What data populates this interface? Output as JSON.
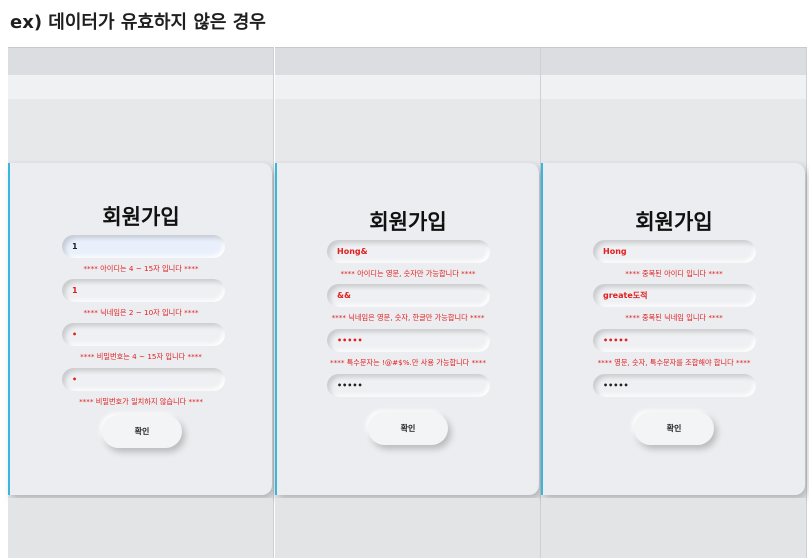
{
  "heading": "ex) 데이터가 유효하지 않은 경우",
  "panels": [
    {
      "title": "회원가입",
      "fields": [
        "1",
        "1",
        "•",
        "•"
      ],
      "errors": [
        "**** 아이디는 4 ~ 15자 입니다 ****",
        "**** 닉네임은 2 ~ 10자 입니다 ****",
        "**** 비밀번호는 4 ~ 15자 입니다 ****",
        "**** 비밀번호가 일치하지 않습니다 ****"
      ],
      "button": "확인"
    },
    {
      "title": "회원가입",
      "fields": [
        "Hong&",
        "&&",
        "•••••",
        "•••••"
      ],
      "errors": [
        "**** 아이디는 영문, 숫자만 가능합니다 ****",
        "**** 닉네임은 영문, 숫자, 한글만 가능합니다 ****",
        "**** 특수문자는 !@#$%.만 사용 가능합니다 ****"
      ],
      "button": "확인"
    },
    {
      "title": "회원가입",
      "fields": [
        "Hong",
        "greate도적",
        "•••••",
        "•••••"
      ],
      "errors": [
        "**** 중복된 아이디 입니다 ****",
        "**** 중복된 닉네임 입니다 ****",
        "**** 영문, 숫자, 특수문자를 조합해야 합니다 ****"
      ],
      "button": "확인"
    }
  ]
}
